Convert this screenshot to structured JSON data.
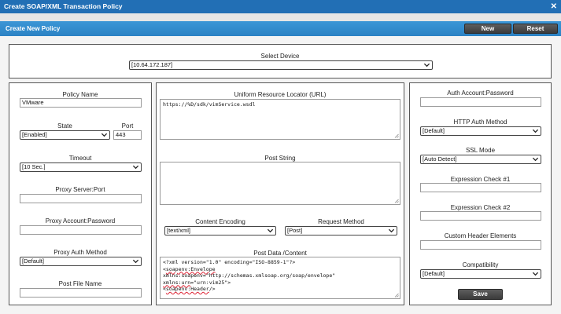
{
  "dialog": {
    "title": "Create SOAP/XML Transaction Policy",
    "close_glyph": "✕"
  },
  "header": {
    "title": "Create New Policy",
    "new_label": "New",
    "reset_label": "Reset"
  },
  "device": {
    "label": "Select Device",
    "value": "[10.64.172.187]"
  },
  "left": {
    "policy_name_label": "Policy Name",
    "policy_name_value": "VMware",
    "state_label": "State",
    "state_value": "[Enabled]",
    "port_label": "Port",
    "port_value": "443",
    "timeout_label": "Timeout",
    "timeout_value": "[10 Sec.]",
    "proxy_server_label": "Proxy Server:Port",
    "proxy_server_value": "",
    "proxy_account_label": "Proxy Account:Password",
    "proxy_account_value": "",
    "proxy_auth_label": "Proxy Auth Method",
    "proxy_auth_value": "[Default]",
    "post_file_label": "Post File Name",
    "post_file_value": ""
  },
  "middle": {
    "url_label": "Uniform Resource Locator (URL)",
    "url_value": "https://%D/sdk/vimService.wsdl",
    "post_string_label": "Post String",
    "post_string_value": "",
    "content_encoding_label": "Content Encoding",
    "content_encoding_value": "[text/xml]",
    "request_method_label": "Request Method",
    "request_method_value": "[Post]",
    "post_data_label": "Post Data /Content",
    "post_data": {
      "line1": "<?xml version=\"1.0\" encoding=\"ISO-8859-1\"?>",
      "line2a": "<",
      "line2b": "soapenv:Envelope",
      "line3": "xmlns:soapenv=\"http://schemas.xmlsoap.org/soap/envelope\"",
      "line4a": "xmlns:urn",
      "line4b": "=\"urn:vim25\">",
      "line5a": "<",
      "line5b": "soapenv:Header",
      "line5c": "/>"
    }
  },
  "right": {
    "auth_account_label": "Auth Account:Password",
    "auth_account_value": "",
    "http_auth_label": "HTTP Auth Method",
    "http_auth_value": "[Default]",
    "ssl_mode_label": "SSL Mode",
    "ssl_mode_value": "[Auto Detect]",
    "expr1_label": "Expression Check #1",
    "expr1_value": "",
    "expr2_label": "Expression Check #2",
    "expr2_value": "",
    "custom_header_label": "Custom Header Elements",
    "custom_header_value": "",
    "compatibility_label": "Compatibility",
    "compatibility_value": "[Default]",
    "save_label": "Save"
  }
}
